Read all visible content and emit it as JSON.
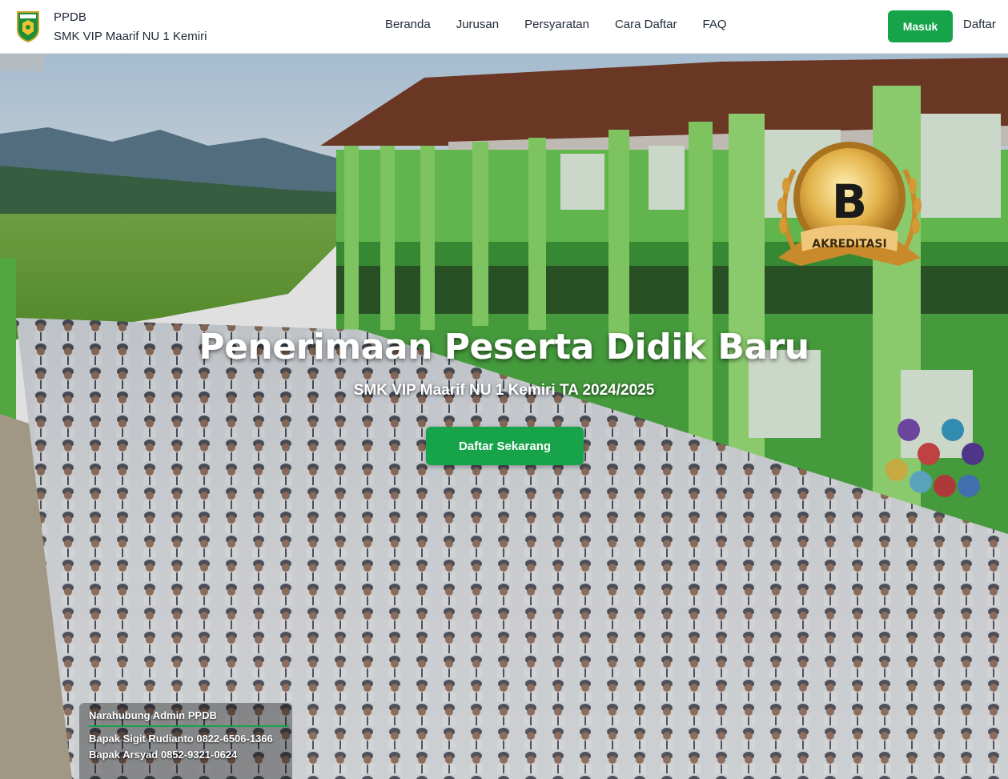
{
  "brand": {
    "logo_icon": "school-shield-logo-icon",
    "short": "PPDB",
    "name": "SMK VIP Maarif NU 1 Kemiri"
  },
  "nav": {
    "items": [
      "Beranda",
      "Jurusan",
      "Persyaratan",
      "Cara Daftar",
      "FAQ"
    ],
    "login_label": "Masuk",
    "register_label": "Daftar"
  },
  "hero": {
    "title": "Penerimaan Peserta Didik Baru",
    "subtitle": "SMK VIP Maarif NU 1 Kemiri TA 2024/2025",
    "cta_label": "Daftar Sekarang",
    "badge": {
      "grade": "B",
      "label": "AKREDITASI"
    }
  },
  "contact": {
    "title": "Narahubung Admin PPDB",
    "lines": [
      "Bapak Sigit Rudianto 0822-6506-1366",
      "Bapak Arsyad 0852-9321-0624"
    ]
  },
  "colors": {
    "accent": "#16a34a",
    "text": "#1f2937"
  }
}
